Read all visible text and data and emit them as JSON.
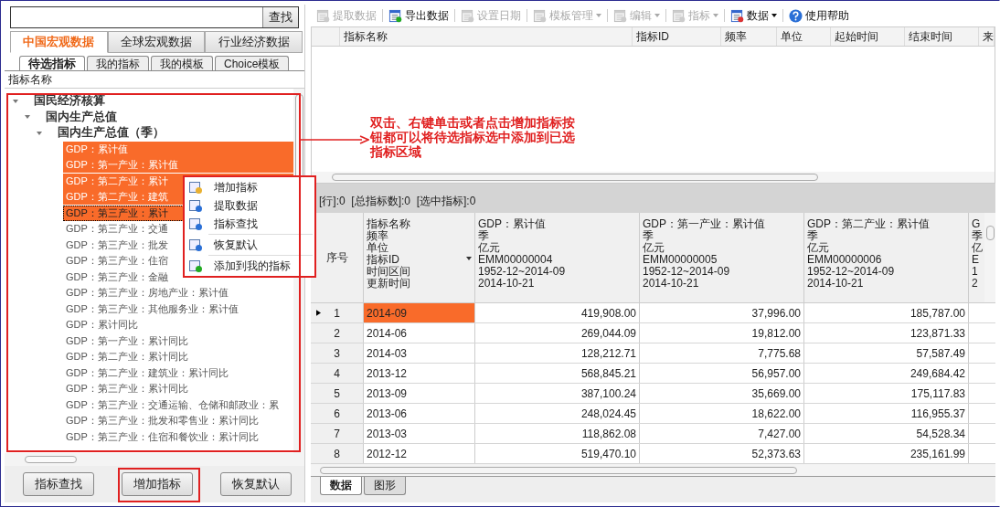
{
  "search": {
    "button": "查找"
  },
  "category_tabs": [
    {
      "label": "中国宏观数据",
      "selected": true
    },
    {
      "label": "全球宏观数据",
      "selected": false
    },
    {
      "label": "行业经济数据",
      "selected": false
    }
  ],
  "sub_tabs": [
    {
      "label": "待选指标",
      "selected": true
    },
    {
      "label": "我的指标",
      "selected": false
    },
    {
      "label": "我的模板",
      "selected": false
    },
    {
      "label": "Choice模板",
      "selected": false
    }
  ],
  "tree": {
    "header": "指标名称",
    "nodes": [
      {
        "label": "国民经济核算",
        "expanded": true,
        "children": [
          {
            "label": "国内生产总值",
            "expanded": true,
            "children": [
              {
                "label": "国内生产总值（季）",
                "expanded": true,
                "children": [
                  {
                    "label": "GDP：累计值",
                    "selected": true,
                    "focused": false
                  },
                  {
                    "label": "GDP：第一产业：累计值",
                    "selected": true,
                    "focused": false
                  },
                  {
                    "label": "GDP：第二产业：累计",
                    "selected": true,
                    "focused": false
                  },
                  {
                    "label": "GDP：第二产业：建筑",
                    "selected": true,
                    "focused": false
                  },
                  {
                    "label": "GDP：第三产业：累计",
                    "selected": true,
                    "focused": true
                  },
                  {
                    "label": "GDP：第三产业：交通",
                    "selected": false,
                    "focused": false
                  },
                  {
                    "label": "GDP：第三产业：批发",
                    "selected": false,
                    "focused": false
                  },
                  {
                    "label": "GDP：第三产业：住宿",
                    "selected": false,
                    "focused": false
                  },
                  {
                    "label": "GDP：第三产业：金融",
                    "selected": false,
                    "focused": false
                  },
                  {
                    "label": "GDP：第三产业：房地产业：累计值",
                    "selected": false,
                    "focused": false
                  },
                  {
                    "label": "GDP：第三产业：其他服务业：累计值",
                    "selected": false,
                    "focused": false
                  },
                  {
                    "label": "GDP：累计同比",
                    "selected": false,
                    "focused": false
                  },
                  {
                    "label": "GDP：第一产业：累计同比",
                    "selected": false,
                    "focused": false
                  },
                  {
                    "label": "GDP：第二产业：累计同比",
                    "selected": false,
                    "focused": false
                  },
                  {
                    "label": "GDP：第二产业：建筑业：累计同比",
                    "selected": false,
                    "focused": false
                  },
                  {
                    "label": "GDP：第三产业：累计同比",
                    "selected": false,
                    "focused": false
                  },
                  {
                    "label": "GDP：第三产业：交通运输、仓储和邮政业：累",
                    "selected": false,
                    "focused": false
                  },
                  {
                    "label": "GDP：第三产业：批发和零售业：累计同比",
                    "selected": false,
                    "focused": false
                  },
                  {
                    "label": "GDP：第三产业：住宿和餐饮业：累计同比",
                    "selected": false,
                    "focused": false
                  }
                ]
              }
            ]
          }
        ]
      }
    ]
  },
  "context_menu": [
    [
      "增加指标",
      "提取数据",
      "指标查找"
    ],
    [
      "恢复默认"
    ],
    [
      "添加到我的指标"
    ]
  ],
  "bottom_buttons": [
    "指标查找",
    "增加指标",
    "恢复默认"
  ],
  "annotation": "双击、右键单击或者点击增加指标按钮都可以将待选指标选中添加到已选指标区域",
  "toolbar": [
    {
      "label": "提取数据",
      "disabled": true,
      "dropdown": false
    },
    {
      "label": "导出数据",
      "disabled": false,
      "dropdown": false
    },
    {
      "label": "设置日期",
      "disabled": true,
      "dropdown": false
    },
    {
      "label": "模板管理",
      "disabled": true,
      "dropdown": true
    },
    {
      "label": "编辑",
      "disabled": true,
      "dropdown": true
    },
    {
      "label": "指标",
      "disabled": true,
      "dropdown": true
    },
    {
      "label": "数据",
      "disabled": false,
      "dropdown": true
    },
    {
      "label": "使用帮助",
      "disabled": false,
      "dropdown": false
    }
  ],
  "selected_indicators": {
    "columns": [
      "指标名称",
      "指标ID",
      "频率",
      "单位",
      "起始时间",
      "结束时间",
      "来"
    ]
  },
  "stats": "[行]:0  [总指标数]:0  [选中指标]:0",
  "data_grid": {
    "index_header": "序号",
    "field_header": [
      "指标名称",
      "频率",
      "单位",
      "指标ID",
      "时间区间",
      "更新时间"
    ],
    "columns": [
      [
        "GDP：累计值",
        "季",
        "亿元",
        "EMM00000004",
        "1952-12~2014-09",
        "2014-10-21"
      ],
      [
        "GDP：第一产业：累计值",
        "季",
        "亿元",
        "EMM00000005",
        "1952-12~2014-09",
        "2014-10-21"
      ],
      [
        "GDP：第二产业：累计值",
        "季",
        "亿元",
        "EMM00000006",
        "1952-12~2014-09",
        "2014-10-21"
      ],
      [
        "G",
        "季",
        "亿",
        "E",
        "1",
        "2"
      ]
    ],
    "rows": [
      {
        "index": "1",
        "period": "2014-09",
        "values": [
          "419,908.00",
          "37,996.00",
          "185,787.00"
        ],
        "selected": true
      },
      {
        "index": "2",
        "period": "2014-06",
        "values": [
          "269,044.09",
          "19,812.00",
          "123,871.33"
        ],
        "selected": false
      },
      {
        "index": "3",
        "period": "2014-03",
        "values": [
          "128,212.71",
          "7,775.68",
          "57,587.49"
        ],
        "selected": false
      },
      {
        "index": "4",
        "period": "2013-12",
        "values": [
          "568,845.21",
          "56,957.00",
          "249,684.42"
        ],
        "selected": false
      },
      {
        "index": "5",
        "period": "2013-09",
        "values": [
          "387,100.24",
          "35,669.00",
          "175,117.83"
        ],
        "selected": false
      },
      {
        "index": "6",
        "period": "2013-06",
        "values": [
          "248,024.45",
          "18,622.00",
          "116,955.37"
        ],
        "selected": false
      },
      {
        "index": "7",
        "period": "2013-03",
        "values": [
          "118,862.08",
          "7,427.00",
          "54,528.34"
        ],
        "selected": false
      },
      {
        "index": "8",
        "period": "2012-12",
        "values": [
          "519,470.10",
          "52,373.63",
          "235,161.99"
        ],
        "selected": false
      }
    ]
  },
  "bottom_tabs": [
    {
      "label": "数据",
      "selected": true
    },
    {
      "label": "图形",
      "selected": false
    }
  ]
}
